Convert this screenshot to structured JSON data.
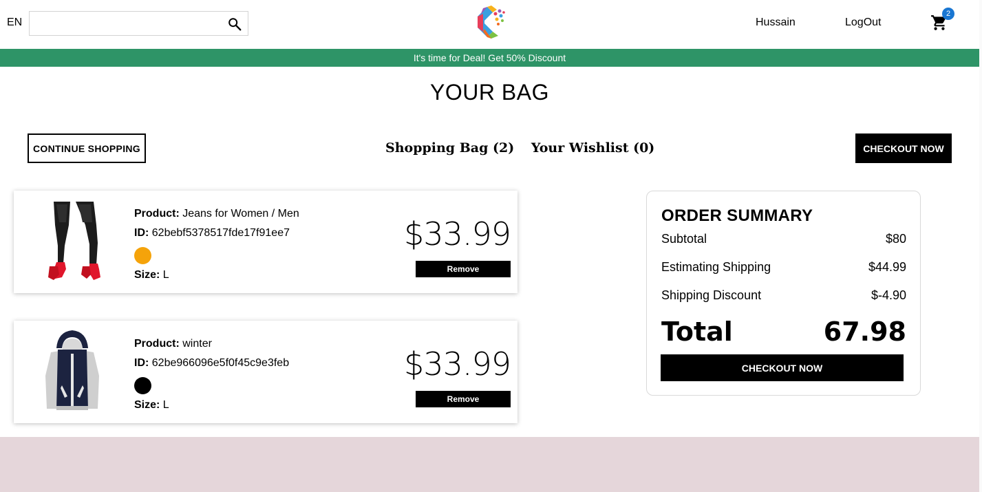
{
  "nav": {
    "language": "EN",
    "search_placeholder": "",
    "user_name": "Hussain",
    "logout_label": "LogOut",
    "cart_count": "2"
  },
  "announcement": "It's time for Deal! Get 50% Discount",
  "page_title": "YOUR BAG",
  "top_bar": {
    "continue_label": "CONTINUE SHOPPING",
    "shopping_bag_label": "Shopping Bag (2)",
    "wishlist_label": "Your Wishlist (0)",
    "checkout_label": "CHECKOUT NOW"
  },
  "labels": {
    "product": "Product:",
    "id": "ID:",
    "size": "Size:",
    "remove": "Remove"
  },
  "products": [
    {
      "name": "Jeans for Women / Men",
      "id": "62bebf5378517fde17f91ee7",
      "color": "#f5a30a",
      "size": "L",
      "price": "$33.99"
    },
    {
      "name": "winter",
      "id": "62be966096e5f0f45c9e3feb",
      "color": "#000000",
      "size": "L",
      "price": "$33.99"
    }
  ],
  "summary": {
    "title": "ORDER SUMMARY",
    "subtotal_label": "Subtotal",
    "subtotal_value": "$80",
    "shipping_label": "Estimating Shipping",
    "shipping_value": "$44.99",
    "discount_label": "Shipping Discount",
    "discount_value": "$-4.90",
    "total_label": "Total",
    "total_value": "67.98",
    "checkout_label": "CHECKOUT NOW"
  },
  "colors": {
    "announcement_bg": "#2e9467",
    "footer_bg": "#e5d6da",
    "badge_bg": "#1976d2"
  }
}
